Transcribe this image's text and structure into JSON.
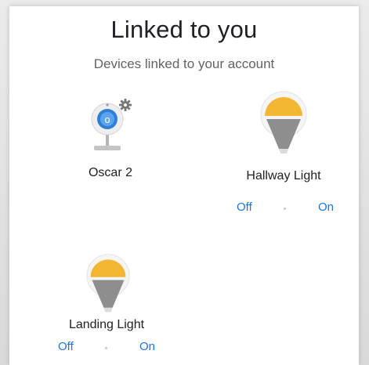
{
  "header": {
    "title": "Linked to you",
    "subtitle": "Devices linked to your account"
  },
  "devices": [
    {
      "name": "Oscar 2",
      "icon": "camera-icon",
      "has_controls": false
    },
    {
      "name": "Hallway Light",
      "icon": "light-bulb-icon",
      "has_controls": true,
      "off_label": "Off",
      "on_label": "On"
    },
    {
      "name": "Landing Light",
      "icon": "light-bulb-icon",
      "has_controls": true,
      "off_label": "Off",
      "on_label": "On"
    }
  ],
  "colors": {
    "accent": "#1a73e8",
    "bulb_top": "#f2b632",
    "bulb_body": "#8e8e8e",
    "camera_lens": "#2f7fd6"
  }
}
